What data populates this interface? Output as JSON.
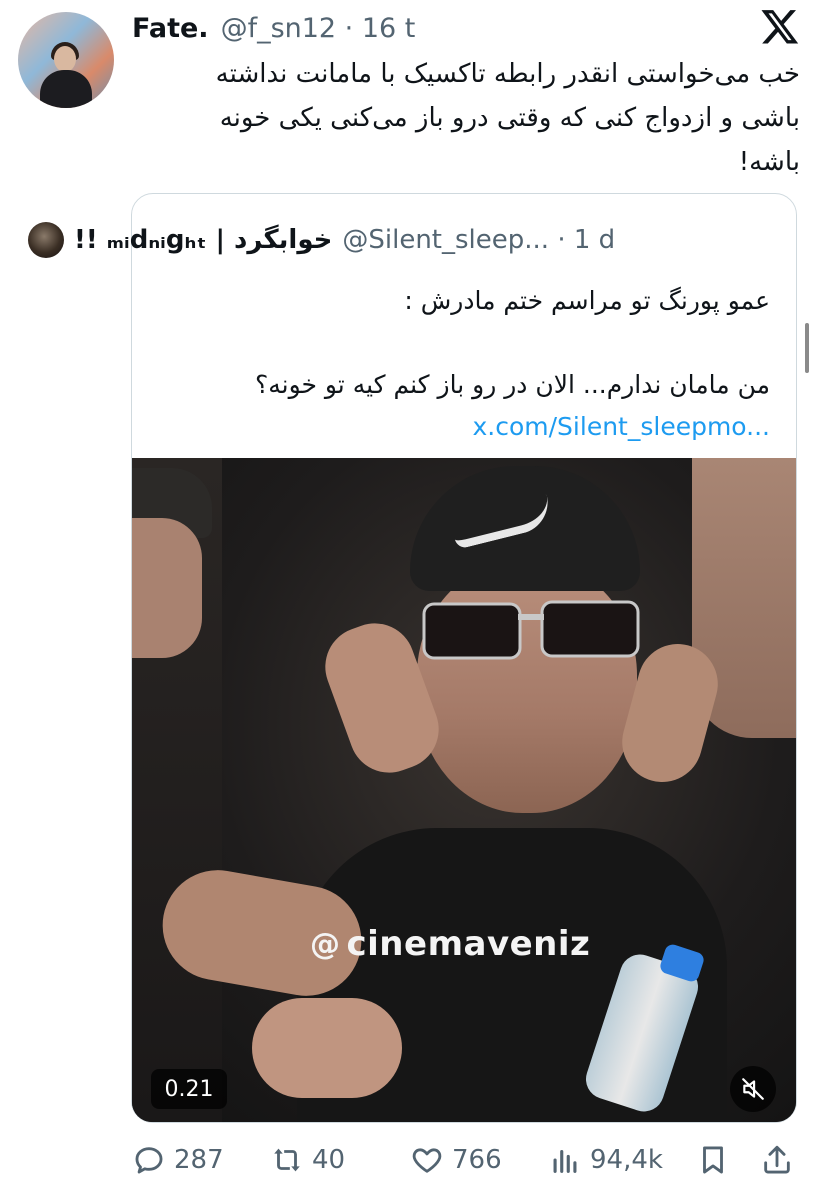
{
  "post": {
    "author_name": "Fate.",
    "author_handle": "@f_sn12 · 16 t",
    "text_lines": [
      "خب می‌خواستی انقدر رابطه تاکسیک با مامانت نداشته",
      "باشی و ازدواج کنی که وقتی درو باز می‌کنی یکی خونه",
      "باشه!"
    ]
  },
  "quoted": {
    "author_name": "!! ₘᵢdₙᵢgₕₜ | خوابگرد",
    "author_handle": "@Silent_sleep... · 1 d",
    "line1": "عمو پورنگ تو مراسم ختم مادرش :",
    "line2": "من مامان ندارم... الان در رو باز کنم کیه تو خونه؟",
    "link": "x.com/Silent_sleepmo...",
    "video": {
      "watermark": "cinemaveniz",
      "duration": "0.21"
    }
  },
  "actions": {
    "replies": "287",
    "reposts": "40",
    "likes": "766",
    "views": "94,4k"
  },
  "icons": [
    "x-logo-icon",
    "reply-icon",
    "repost-icon",
    "like-icon",
    "views-icon",
    "bookmark-icon",
    "share-icon",
    "mute-icon",
    "threads-icon"
  ],
  "colors": {
    "link": "#1d9bf0",
    "secondary_text": "#536471",
    "border": "#cfd9de"
  }
}
